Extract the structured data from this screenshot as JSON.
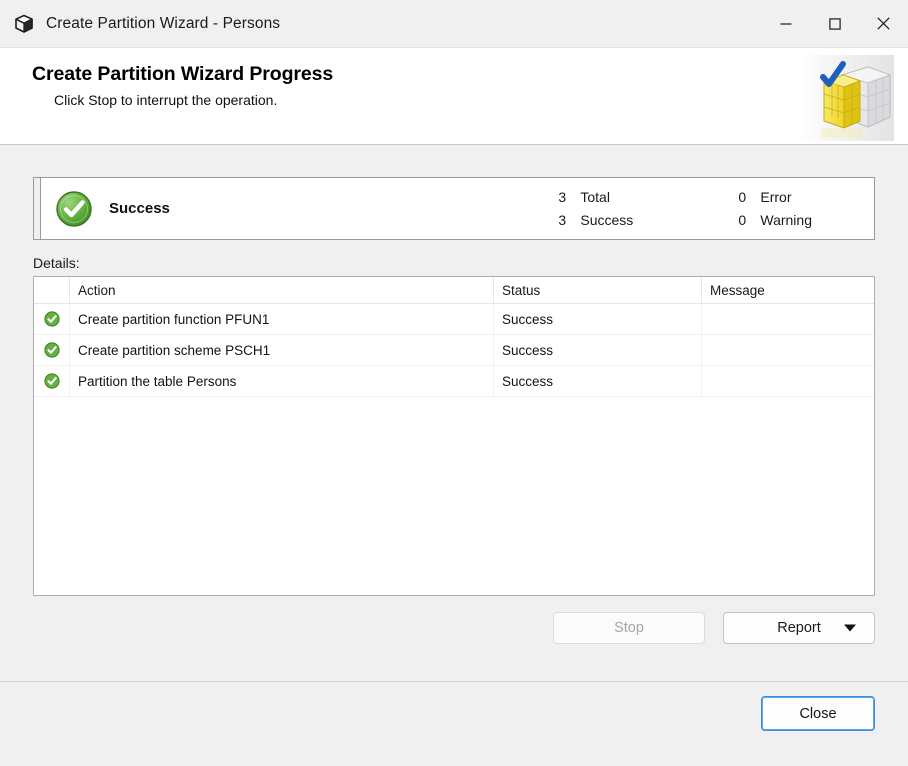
{
  "window": {
    "title": "Create Partition Wizard - Persons",
    "app_icon": "cube-icon",
    "controls": {
      "minimize": "minimize-icon",
      "maximize": "maximize-icon",
      "close": "close-icon"
    }
  },
  "banner": {
    "title": "Create Partition Wizard Progress",
    "subtitle": "Click Stop to interrupt the operation.",
    "art": "partition-blocks-check-icon"
  },
  "summary": {
    "icon": "success-check-icon",
    "label": "Success",
    "stats": [
      {
        "count": "3",
        "name": "Total"
      },
      {
        "count": "3",
        "name": "Success"
      },
      {
        "count": "0",
        "name": "Error"
      },
      {
        "count": "0",
        "name": "Warning"
      }
    ]
  },
  "details": {
    "label": "Details:",
    "columns": [
      "",
      "Action",
      "Status",
      "Message"
    ],
    "rows": [
      {
        "icon": "success-check-icon",
        "action": "Create partition function PFUN1",
        "status": "Success",
        "message": ""
      },
      {
        "icon": "success-check-icon",
        "action": "Create partition scheme PSCH1",
        "status": "Success",
        "message": ""
      },
      {
        "icon": "success-check-icon",
        "action": "Partition the table Persons",
        "status": "Success",
        "message": ""
      }
    ]
  },
  "buttons": {
    "stop": "Stop",
    "stop_enabled": false,
    "report": "Report",
    "report_caret": "chevron-down-icon",
    "close": "Close"
  },
  "colors": {
    "success_green": "#4aa832",
    "focus_blue": "#3d8ddd",
    "banner_bg": "#ffffff",
    "window_bg": "#f0f0f0",
    "art_yellow": "#f2dc3c",
    "art_check_blue": "#1f5fbf"
  }
}
